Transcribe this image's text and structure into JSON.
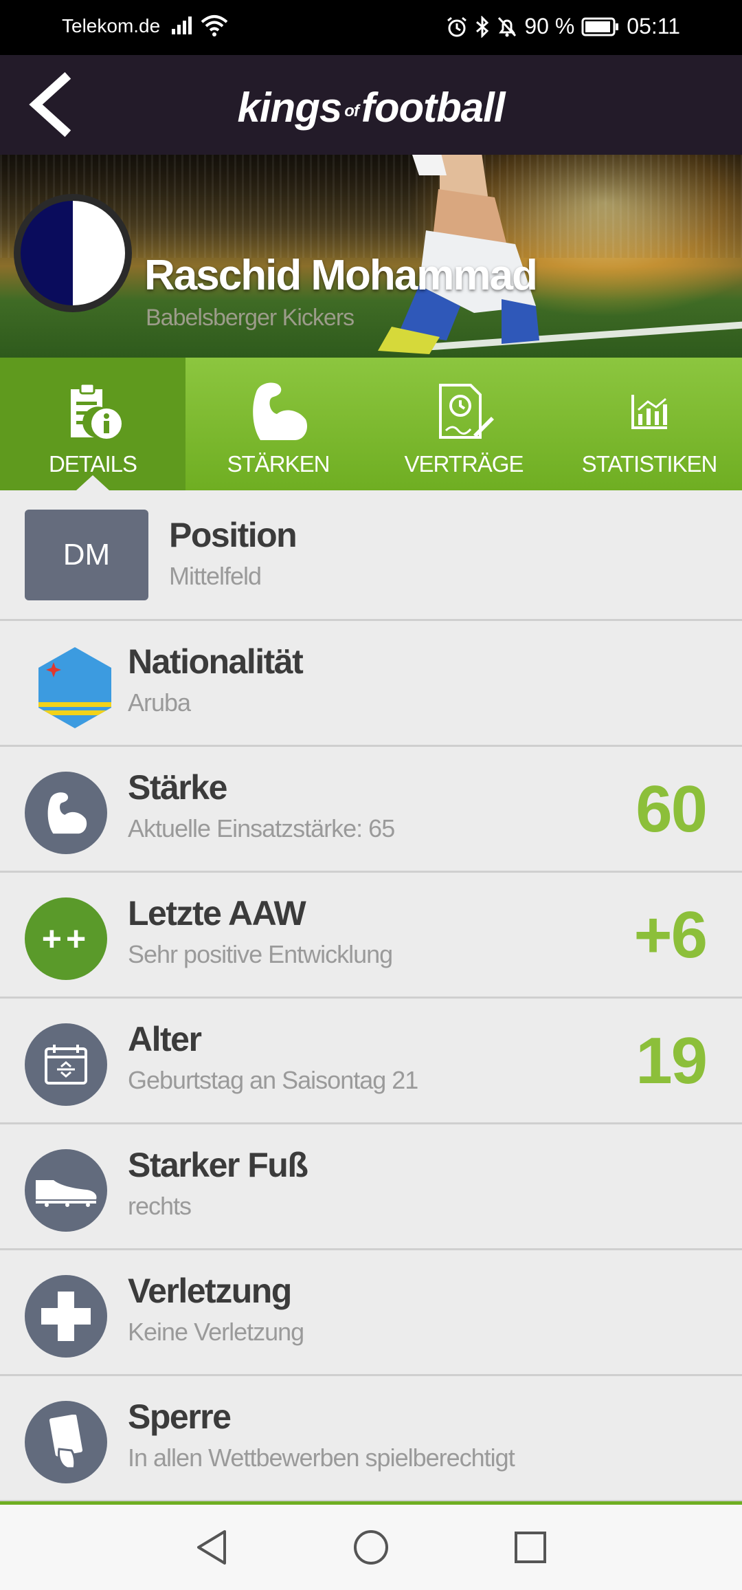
{
  "status_bar": {
    "carrier": "Telekom.de",
    "battery": "90 %",
    "time": "05:11"
  },
  "app": {
    "logo_part1": "kings",
    "logo_of": "of",
    "logo_part2": "football"
  },
  "player": {
    "name": "Raschid Mohammad",
    "club": "Babelsberger Kickers"
  },
  "tabs": [
    {
      "label": "DETAILS",
      "icon": "document-info-icon",
      "active": true
    },
    {
      "label": "STÄRKEN",
      "icon": "muscle-icon",
      "active": false
    },
    {
      "label": "VERTRÄGE",
      "icon": "contract-icon",
      "active": false
    },
    {
      "label": "STATISTIKEN",
      "icon": "chart-icon",
      "active": false
    }
  ],
  "details": {
    "position": {
      "badge": "DM",
      "title": "Position",
      "subtitle": "Mittelfeld"
    },
    "nationality": {
      "title": "Nationalität",
      "subtitle": "Aruba",
      "icon": "flag-aruba-icon"
    },
    "strength": {
      "title": "Stärke",
      "subtitle": "Aktuelle Einsatzstärke: 65",
      "value": "60",
      "icon": "muscle-icon"
    },
    "last_aaw": {
      "title": "Letzte AAW",
      "subtitle": "Sehr positive Entwicklung",
      "value": "+6",
      "badge": "++"
    },
    "age": {
      "title": "Alter",
      "subtitle": "Geburtstag an Saisontag 21",
      "value": "19",
      "icon": "calendar-icon"
    },
    "foot": {
      "title": "Starker Fuß",
      "subtitle": "rechts",
      "icon": "boot-icon"
    },
    "injury": {
      "title": "Verletzung",
      "subtitle": "Keine Verletzung",
      "icon": "plus-icon"
    },
    "suspension": {
      "title": "Sperre",
      "subtitle": "In allen Wettbewerben spielberechtigt",
      "icon": "card-icon"
    }
  },
  "colors": {
    "accent_green": "#8cc63f",
    "value_green": "#8cbf3a",
    "header_dark": "#231b29",
    "icon_slate": "#626b7d"
  }
}
